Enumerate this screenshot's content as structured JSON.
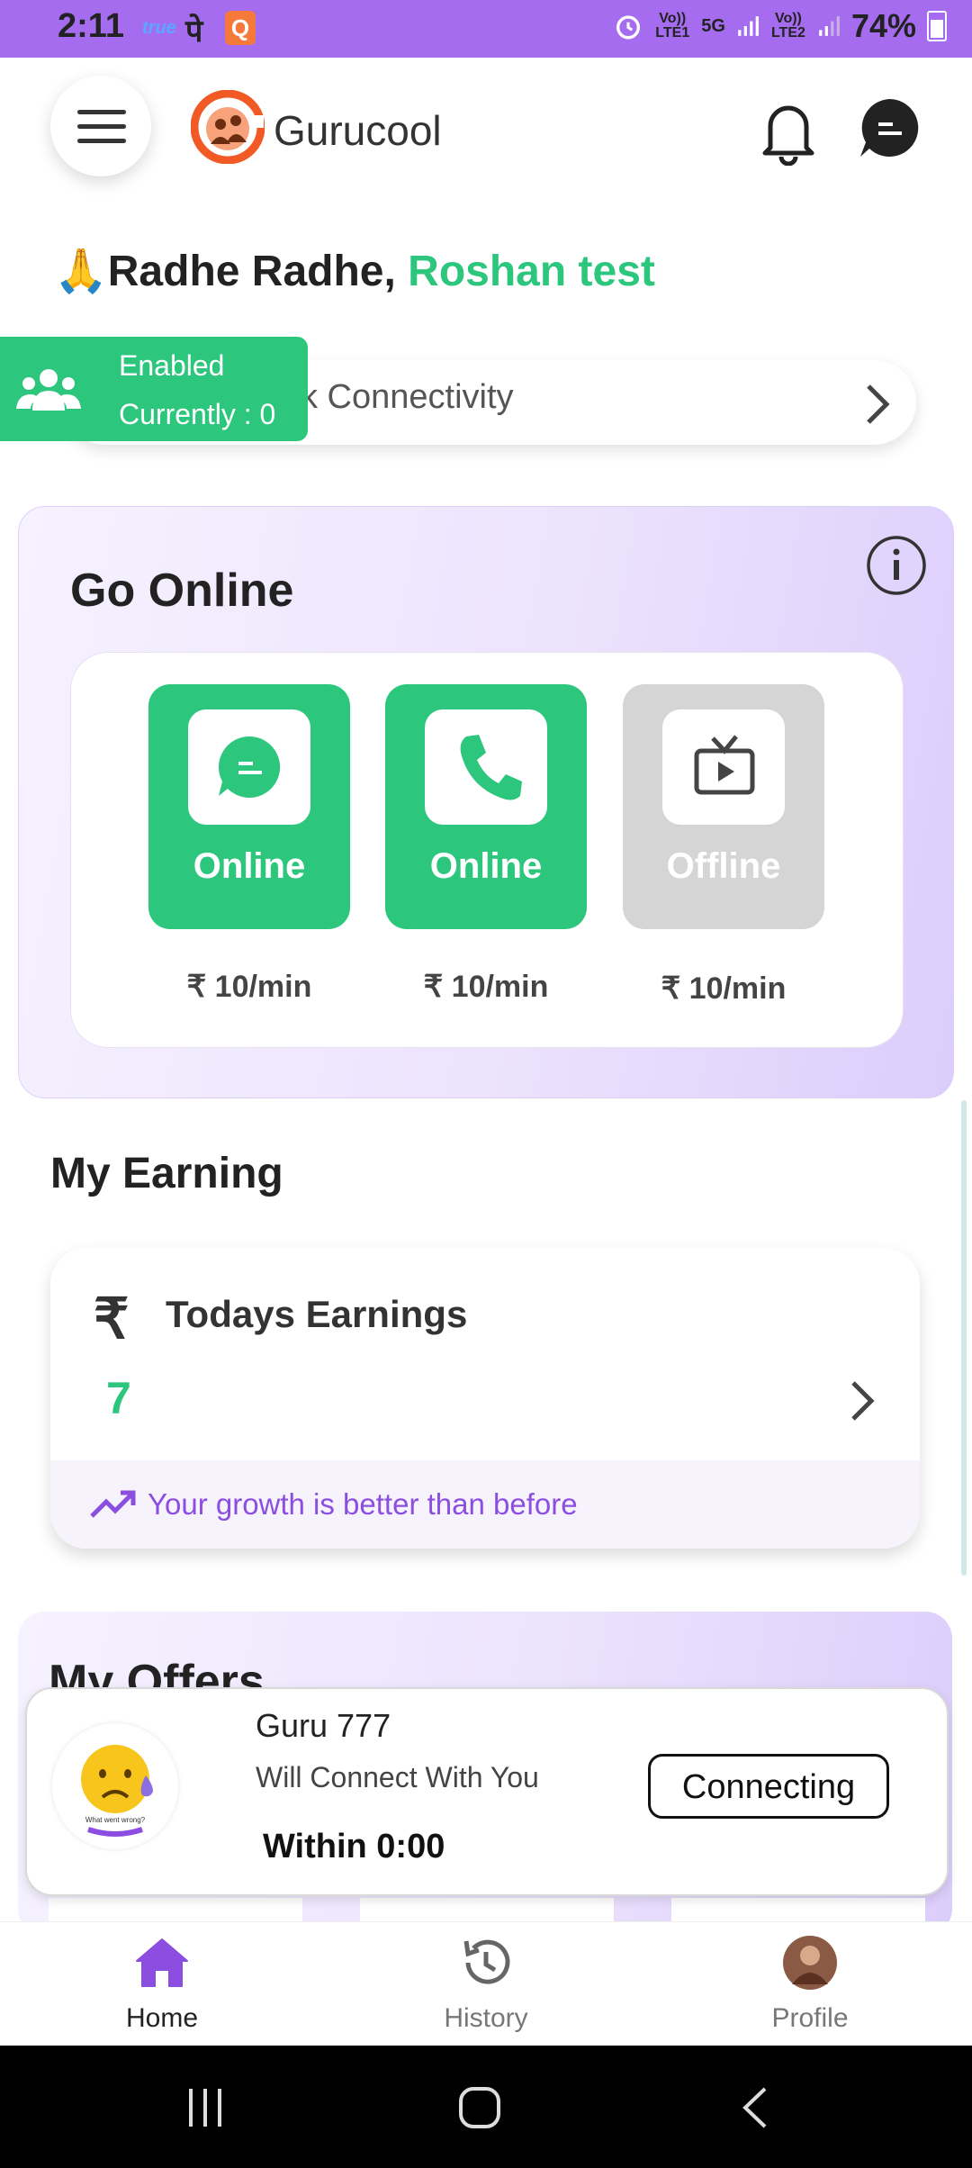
{
  "status_bar": {
    "time": "2:11",
    "carrier_badge": "true",
    "app_pe": "पे",
    "app_q": "Q",
    "lte1": "Vo)) LTE1",
    "network": "5G",
    "lte2": "Vo)) LTE2",
    "battery": "74%"
  },
  "header": {
    "brand": "Gurucool",
    "icons": [
      "menu-icon",
      "gurucool-logo",
      "bell-icon",
      "chat-icon"
    ]
  },
  "greeting": {
    "prefix": "Radhe Radhe,",
    "name": "Roshan test"
  },
  "connectivity": {
    "label": "k Connectivity",
    "badge_status": "Enabled",
    "badge_count": "Currently : 0"
  },
  "go_online": {
    "title": "Go Online",
    "services": [
      {
        "icon": "chat-icon",
        "status": "Online",
        "price": "₹ 10/min",
        "active": true
      },
      {
        "icon": "phone-icon",
        "status": "Online",
        "price": "₹ 10/min",
        "active": true
      },
      {
        "icon": "tv-icon",
        "status": "Offline",
        "price": "₹ 10/min",
        "active": false
      }
    ]
  },
  "earnings": {
    "section_title": "My Earning",
    "label": "Todays Earnings",
    "value": "7",
    "growth": "Your growth is better than before"
  },
  "offers": {
    "title": "My Offers"
  },
  "popup": {
    "name": "Guru 777",
    "subtitle": "Will Connect With You",
    "within": "Within 0:00",
    "button": "Connecting",
    "avatar_caption": "What went wrong?"
  },
  "bottom_nav": {
    "items": [
      {
        "label": "Home",
        "icon": "home-icon",
        "active": true
      },
      {
        "label": "History",
        "icon": "history-icon",
        "active": false
      },
      {
        "label": "Profile",
        "icon": "profile-avatar",
        "active": false
      }
    ]
  },
  "colors": {
    "accent_purple": "#a56cf0",
    "green": "#2dc67d",
    "offline_grey": "#d5d5d5"
  }
}
